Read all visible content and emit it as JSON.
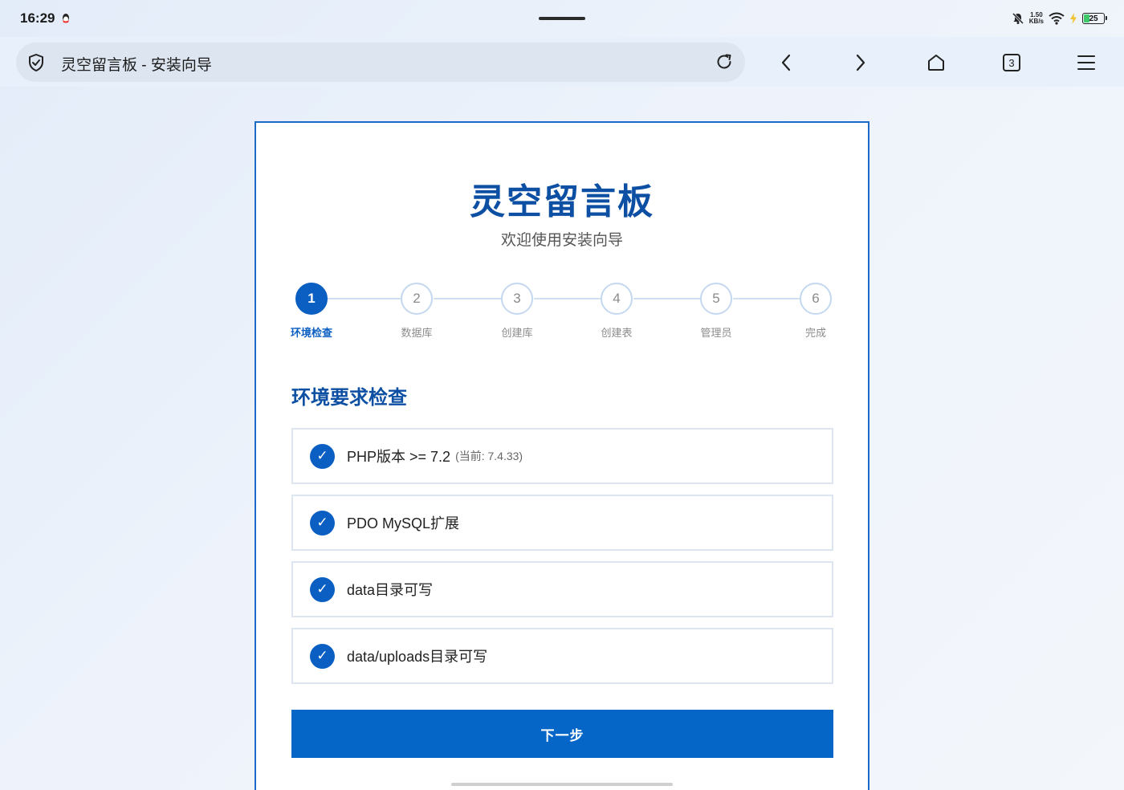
{
  "status_bar": {
    "time": "16:29",
    "net_speed_value": "1.50",
    "net_speed_unit": "KB/s",
    "battery": "25",
    "battery_level": 0.25
  },
  "browser": {
    "url_title": "灵空留言板 - 安装向导",
    "tab_count": "3"
  },
  "page": {
    "title": "灵空留言板",
    "subtitle": "欢迎使用安装向导",
    "steps": [
      {
        "number": "1",
        "label": "环境检查",
        "active": true
      },
      {
        "number": "2",
        "label": "数据库",
        "active": false
      },
      {
        "number": "3",
        "label": "创建库",
        "active": false
      },
      {
        "number": "4",
        "label": "创建表",
        "active": false
      },
      {
        "number": "5",
        "label": "管理员",
        "active": false
      },
      {
        "number": "6",
        "label": "完成",
        "active": false
      }
    ],
    "section_title": "环境要求检查",
    "checks": [
      {
        "mark": "✓",
        "text": "PHP版本 >= 7.2",
        "note": "(当前: 7.4.33)"
      },
      {
        "mark": "✓",
        "text": "PDO MySQL扩展",
        "note": ""
      },
      {
        "mark": "✓",
        "text": "data目录可写",
        "note": ""
      },
      {
        "mark": "✓",
        "text": "data/uploads目录可写",
        "note": ""
      }
    ],
    "next_button": "下一步"
  },
  "colors": {
    "accent": "#0b5fc2",
    "title": "#0d4fa3",
    "button": "#0666c8"
  }
}
